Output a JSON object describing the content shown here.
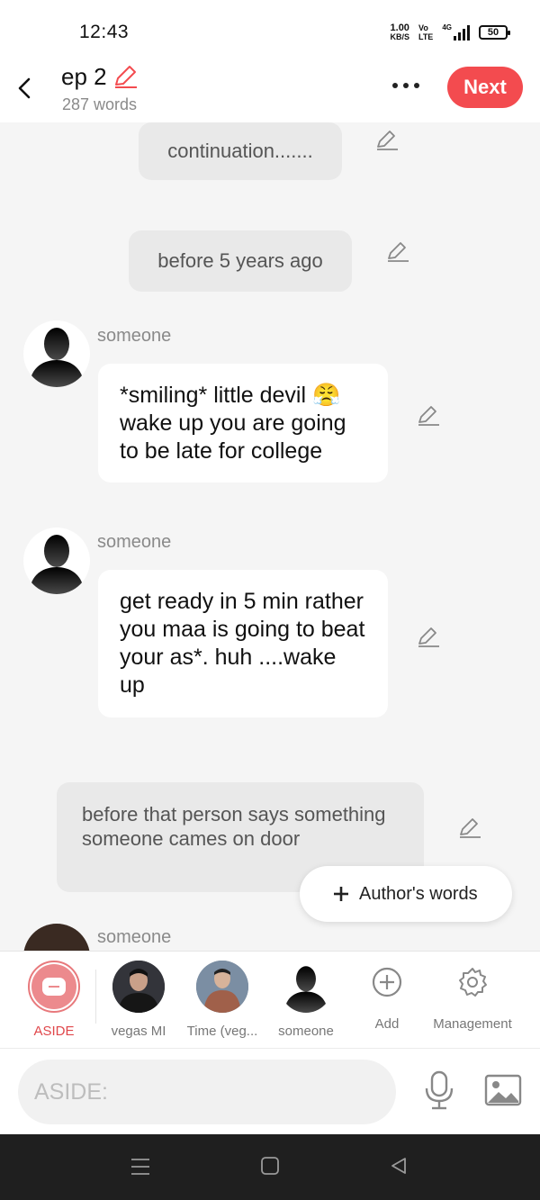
{
  "status": {
    "time": "12:43",
    "speed_value": "1.00",
    "speed_unit": "KB/S",
    "volte_top": "Vo",
    "volte_bottom": "LTE",
    "network": "4G",
    "battery": "50"
  },
  "header": {
    "title": "ep 2",
    "words": "287 words",
    "next_label": "Next"
  },
  "chat": {
    "aside1": "continuation.......",
    "aside2": "before 5 years ago",
    "msg1_speaker": "someone",
    "msg1_text": "*smiling* little devil 😤 wake up you are going to be late for college",
    "msg2_speaker": "someone",
    "msg2_text": "get ready in 5 min rather you maa is going to  beat your as*. huh ....wake up",
    "aside3": "before that person says something someone cames on door",
    "msg3_speaker": "someone"
  },
  "author_words": {
    "label": "Author's words"
  },
  "characters": [
    {
      "label": "ASIDE"
    },
    {
      "label": "vegas MI"
    },
    {
      "label": "Time (veg..."
    },
    {
      "label": "someone"
    },
    {
      "label": "Add"
    },
    {
      "label": "Management"
    }
  ],
  "composer": {
    "placeholder": "ASIDE:"
  },
  "colors": {
    "accent": "#f34b4f",
    "bubble_aside": "#e9e9e9",
    "background": "#f5f5f5"
  }
}
